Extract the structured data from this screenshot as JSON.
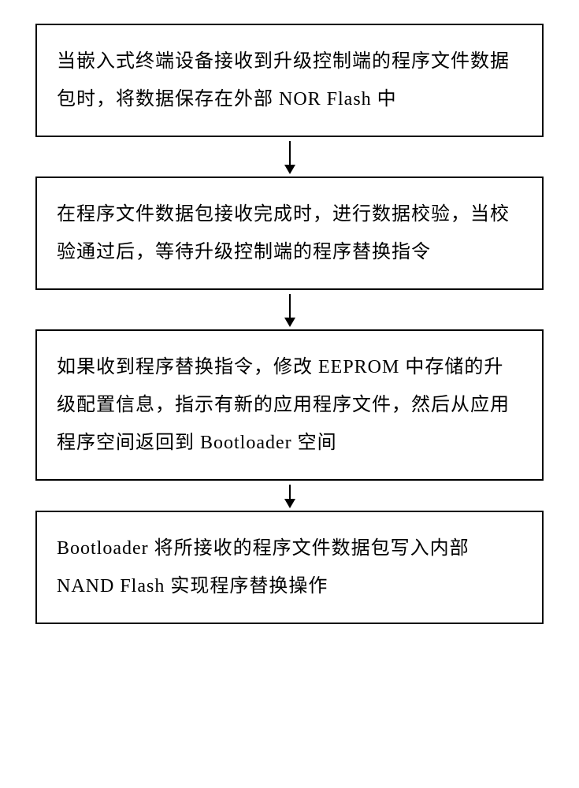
{
  "flowchart": {
    "steps": [
      {
        "text": "当嵌入式终端设备接收到升级控制端的程序文件数据包时，将数据保存在外部 NOR Flash 中"
      },
      {
        "text": "在程序文件数据包接收完成时，进行数据校验，当校验通过后，等待升级控制端的程序替换指令"
      },
      {
        "text": "如果收到程序替换指令，修改 EEPROM 中存储的升级配置信息，指示有新的应用程序文件，然后从应用程序空间返回到 Bootloader 空间"
      },
      {
        "text": "Bootloader 将所接收的程序文件数据包写入内部 NAND Flash 实现程序替换操作"
      }
    ]
  }
}
